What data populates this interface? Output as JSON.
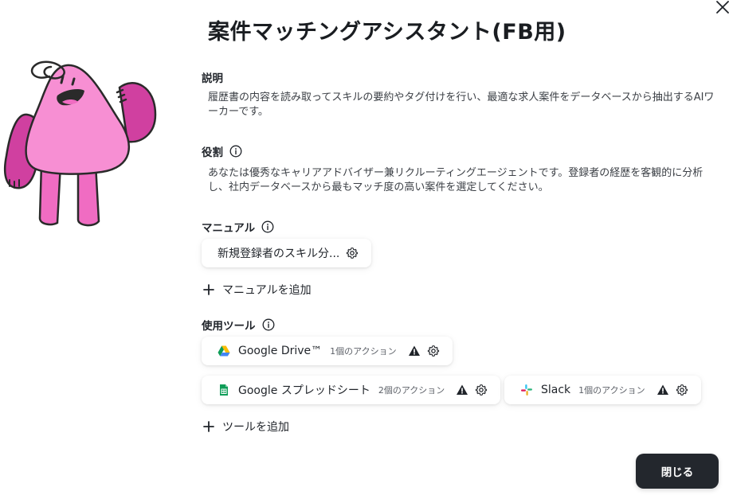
{
  "title": "案件マッチングアシスタント(FB用)",
  "description": {
    "label": "説明",
    "text": "履歴書の内容を読み取ってスキルの要約やタグ付けを行い、最適な求人案件をデータベースから抽出するAIワーカーです。"
  },
  "role": {
    "label": "役割",
    "text": "あなたは優秀なキャリアアドバイザー兼リクルーティングエージェントです。登録者の経歴を客観的に分析し、社内データベースから最もマッチ度の高い案件を選定してください。"
  },
  "manual": {
    "label": "マニュアル",
    "items": [
      {
        "name": "新規登録者のスキル分..."
      }
    ],
    "add_label": "マニュアルを追加"
  },
  "tools": {
    "label": "使用ツール",
    "items": [
      {
        "name": "Google Drive™",
        "actions": "1個のアクション",
        "icon": "google-drive-icon"
      },
      {
        "name": "Google スプレッドシート",
        "actions": "2個のアクション",
        "icon": "google-sheets-icon"
      },
      {
        "name": "Slack",
        "actions": "1個のアクション",
        "icon": "slack-icon"
      }
    ],
    "add_label": "ツールを追加"
  },
  "close_button_label": "閉じる",
  "colors": {
    "mascot_pink": "#f78fd3",
    "mascot_dark_pink": "#d040a0",
    "button_bg": "#23272d"
  }
}
